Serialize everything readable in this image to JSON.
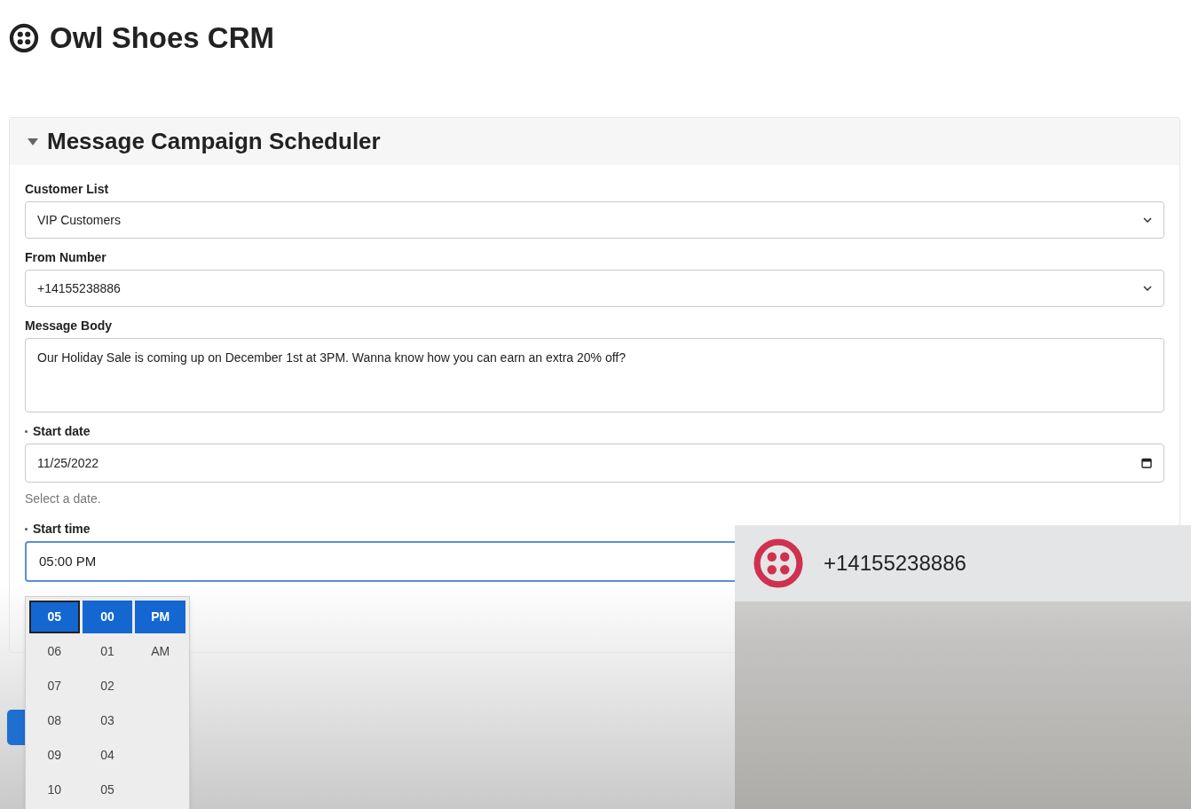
{
  "app": {
    "title": "Owl Shoes CRM"
  },
  "section": {
    "title": "Message Campaign Scheduler",
    "expanded": true
  },
  "fields": [
    {
      "kind": "select",
      "label": "Customer List",
      "required": false,
      "value": "VIP Customers"
    },
    {
      "kind": "select",
      "label": "From Number",
      "required": false,
      "value": "+14155238886"
    },
    {
      "kind": "textarea",
      "label": "Message Body",
      "required": false,
      "value": "Our Holiday Sale is coming up on December 1st at 3PM. Wanna know how you can earn an extra 20% off?"
    },
    {
      "kind": "date",
      "label": "Start date",
      "required": true,
      "value": "11/25/2022",
      "help": "Select a date."
    },
    {
      "kind": "time",
      "label": "Start time",
      "required": true,
      "value": "05:00 PM",
      "focused": true
    }
  ],
  "time_picker": {
    "columns": [
      [
        {
          "label": "05",
          "selected": true
        },
        {
          "label": "06",
          "selected": false
        },
        {
          "label": "07",
          "selected": false
        },
        {
          "label": "08",
          "selected": false
        },
        {
          "label": "09",
          "selected": false
        },
        {
          "label": "10",
          "selected": false
        }
      ],
      [
        {
          "label": "00",
          "selected": true
        },
        {
          "label": "01",
          "selected": false
        },
        {
          "label": "02",
          "selected": false
        },
        {
          "label": "03",
          "selected": false
        },
        {
          "label": "04",
          "selected": false
        },
        {
          "label": "05",
          "selected": false
        }
      ],
      [
        {
          "label": "PM",
          "selected": true
        },
        {
          "label": "AM",
          "selected": false
        }
      ]
    ]
  },
  "caller_overlay": {
    "number": "+14155238886"
  }
}
